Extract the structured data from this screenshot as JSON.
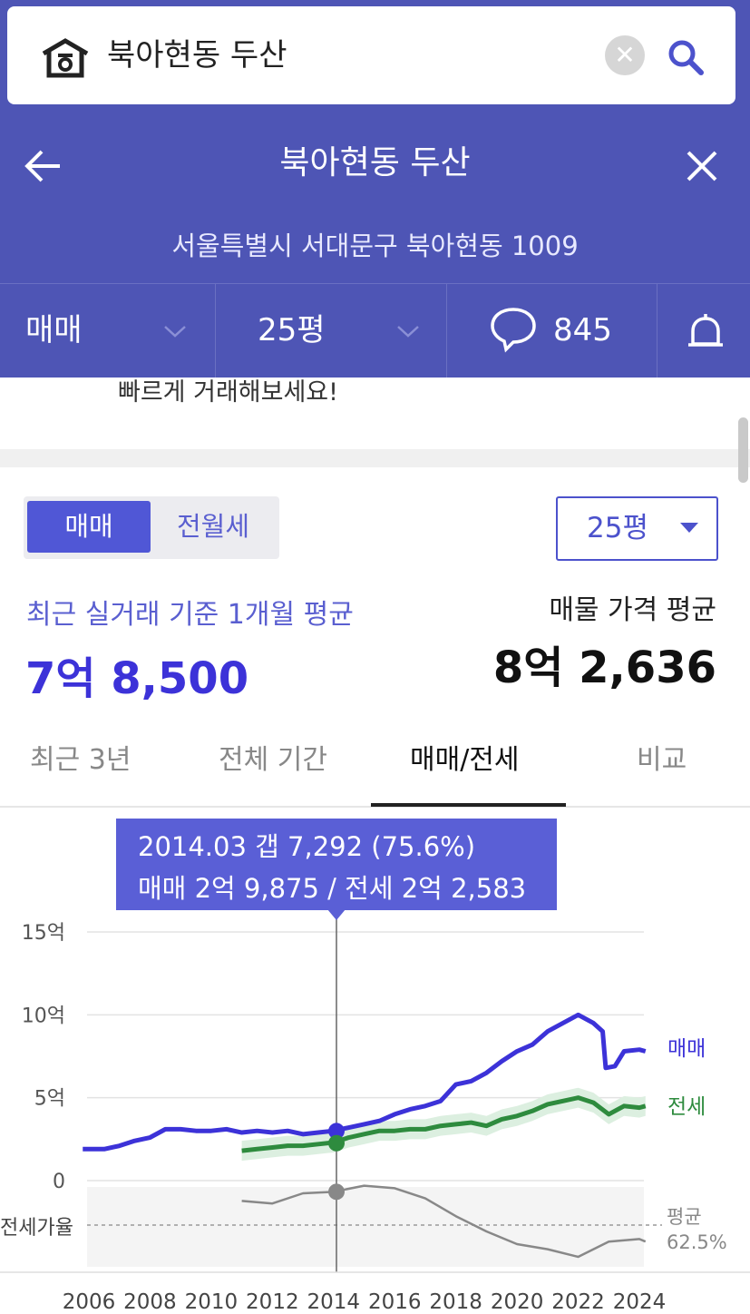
{
  "search": {
    "query": "북아현동 두산",
    "logo_icon": "home-logo-icon",
    "clear_icon": "clear-icon",
    "search_icon": "search-icon",
    "clear_glyph": "✕"
  },
  "header": {
    "title": "북아현동 두산",
    "address": "서울특별시 서대문구 북아현동 1009",
    "back_icon": "back-arrow-icon",
    "close_icon": "close-icon"
  },
  "filters": {
    "deal_type": "매매",
    "size": "25평",
    "comment_count": "845",
    "comment_icon": "chat-bubble-icon",
    "bell_icon": "bell-icon"
  },
  "promo": {
    "cut_text": "빠르게 거래해보세요!"
  },
  "price": {
    "toggle": {
      "active": "매매",
      "inactive": "전월세"
    },
    "size_select": "25평",
    "recent_label": "최근 실거래 기준 1개월 평균",
    "recent_value": "7억 8,500",
    "listing_label": "매물 가격 평균",
    "listing_value": "8억 2,636"
  },
  "tabs": [
    {
      "label": "최근 3년",
      "active": false
    },
    {
      "label": "전체 기간",
      "active": false
    },
    {
      "label": "매매/전세",
      "active": true
    },
    {
      "label": "비교",
      "active": false
    }
  ],
  "tooltip": {
    "line1": "2014.03  갭 7,292 (75.6%)",
    "line2": "매매 2억 9,875 / 전세 2억 2,583"
  },
  "colors": {
    "brand": "#4e55b5",
    "sale": "#3c32d8",
    "jeonse": "#2e8b3e",
    "ratio": "#888888"
  },
  "chart_data": {
    "type": "line",
    "x_ticks": [
      "2006",
      "2008",
      "2010",
      "2012",
      "2014",
      "2016",
      "2018",
      "2020",
      "2022",
      "2024"
    ],
    "y_ticks": [
      "15억",
      "10억",
      "5억",
      "0"
    ],
    "ylim": [
      0,
      15
    ],
    "y_unit": "억",
    "grid": true,
    "lower_panel_label": "전세가율",
    "average_label": "평균",
    "average_value": "62.5%",
    "selected_point": {
      "x": "2014.03",
      "sale": 2.9875,
      "jeonse": 2.2583,
      "ratio": 75.6
    },
    "series": [
      {
        "name": "매매",
        "points": [
          [
            2005.8,
            1.9
          ],
          [
            2006.5,
            1.9
          ],
          [
            2007,
            2.1
          ],
          [
            2007.5,
            2.4
          ],
          [
            2008,
            2.6
          ],
          [
            2008.5,
            3.1
          ],
          [
            2009,
            3.1
          ],
          [
            2009.5,
            3.0
          ],
          [
            2010,
            3.0
          ],
          [
            2010.5,
            3.1
          ],
          [
            2011,
            2.9
          ],
          [
            2011.5,
            3.0
          ],
          [
            2012,
            2.9
          ],
          [
            2012.5,
            3.0
          ],
          [
            2013,
            2.8
          ],
          [
            2013.5,
            2.9
          ],
          [
            2014,
            3.0
          ],
          [
            2014.5,
            3.2
          ],
          [
            2015,
            3.4
          ],
          [
            2015.5,
            3.6
          ],
          [
            2016,
            4.0
          ],
          [
            2016.5,
            4.3
          ],
          [
            2017,
            4.5
          ],
          [
            2017.5,
            4.8
          ],
          [
            2018,
            5.8
          ],
          [
            2018.5,
            6.0
          ],
          [
            2019,
            6.5
          ],
          [
            2019.5,
            7.2
          ],
          [
            2020,
            7.8
          ],
          [
            2020.5,
            8.2
          ],
          [
            2021,
            9.0
          ],
          [
            2021.5,
            9.5
          ],
          [
            2022,
            10.0
          ],
          [
            2022.5,
            9.5
          ],
          [
            2022.8,
            9.0
          ],
          [
            2022.9,
            6.8
          ],
          [
            2023.2,
            6.9
          ],
          [
            2023.5,
            7.8
          ],
          [
            2024,
            7.9
          ],
          [
            2024.2,
            7.8
          ]
        ]
      },
      {
        "name": "전세",
        "points": [
          [
            2011,
            1.8
          ],
          [
            2011.5,
            1.9
          ],
          [
            2012,
            2.0
          ],
          [
            2012.5,
            2.1
          ],
          [
            2013,
            2.1
          ],
          [
            2013.5,
            2.2
          ],
          [
            2014,
            2.3
          ],
          [
            2014.5,
            2.6
          ],
          [
            2015,
            2.8
          ],
          [
            2015.5,
            3.0
          ],
          [
            2016,
            3.0
          ],
          [
            2016.5,
            3.1
          ],
          [
            2017,
            3.1
          ],
          [
            2017.5,
            3.3
          ],
          [
            2018,
            3.4
          ],
          [
            2018.5,
            3.5
          ],
          [
            2019,
            3.3
          ],
          [
            2019.5,
            3.7
          ],
          [
            2020,
            3.9
          ],
          [
            2020.5,
            4.2
          ],
          [
            2021,
            4.6
          ],
          [
            2021.5,
            4.8
          ],
          [
            2022,
            5.0
          ],
          [
            2022.5,
            4.7
          ],
          [
            2023,
            4.0
          ],
          [
            2023.5,
            4.5
          ],
          [
            2024,
            4.4
          ],
          [
            2024.2,
            4.5
          ]
        ]
      },
      {
        "name": "전세가율",
        "points": [
          [
            2011,
            72
          ],
          [
            2012,
            71
          ],
          [
            2013,
            75
          ],
          [
            2014,
            75.6
          ],
          [
            2015,
            78
          ],
          [
            2016,
            77
          ],
          [
            2017,
            73
          ],
          [
            2018,
            66
          ],
          [
            2019,
            60
          ],
          [
            2020,
            55
          ],
          [
            2021,
            53
          ],
          [
            2022,
            50
          ],
          [
            2023,
            56
          ],
          [
            2024,
            57
          ],
          [
            2024.2,
            56
          ]
        ]
      }
    ]
  }
}
